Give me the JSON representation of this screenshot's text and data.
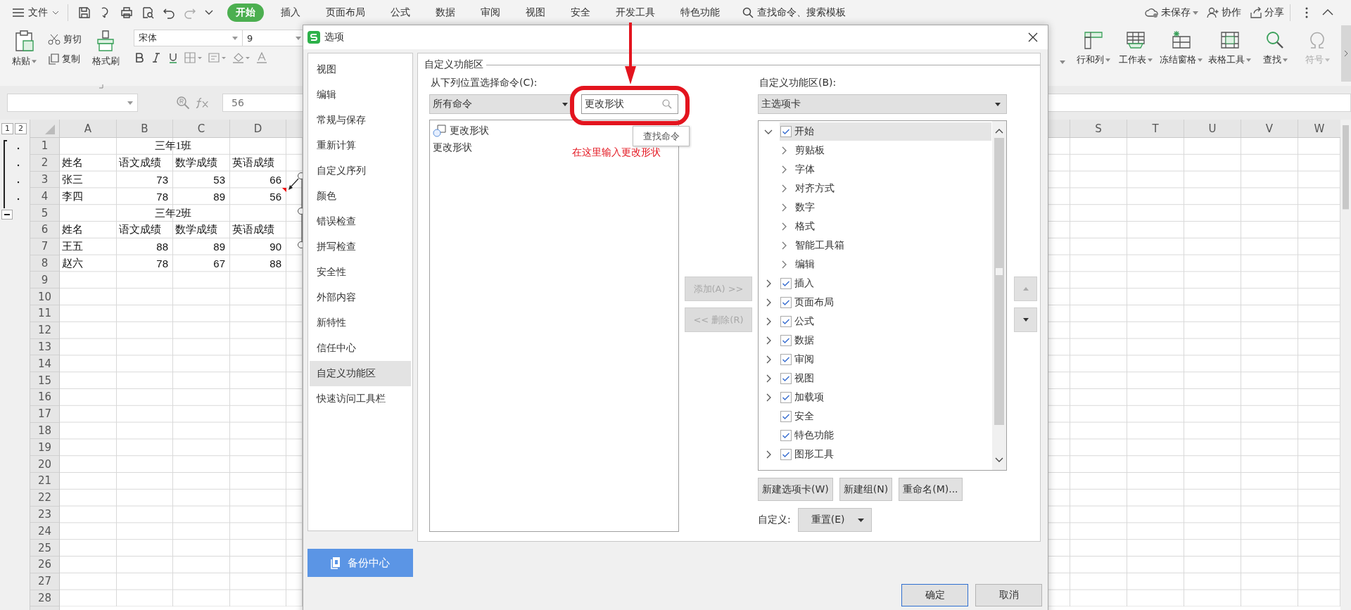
{
  "menu_bar": {
    "file_menu": "文件",
    "tabs": [
      {
        "label": "开始",
        "selected": true
      },
      {
        "label": "插入",
        "selected": false
      },
      {
        "label": "页面布局",
        "selected": false
      },
      {
        "label": "公式",
        "selected": false
      },
      {
        "label": "数据",
        "selected": false
      },
      {
        "label": "审阅",
        "selected": false
      },
      {
        "label": "视图",
        "selected": false
      },
      {
        "label": "安全",
        "selected": false
      },
      {
        "label": "开发工具",
        "selected": false
      },
      {
        "label": "特色功能",
        "selected": false
      }
    ],
    "search": "查找命令、搜索模板",
    "actions": [
      {
        "label": "未保存",
        "kind": "cloud"
      },
      {
        "label": "协作",
        "kind": "people"
      },
      {
        "label": "分享",
        "kind": "share"
      }
    ]
  },
  "ribbon": {
    "paste": "粘贴",
    "cut": "剪切",
    "copy": "复制",
    "format_painter": "格式刷",
    "font_name": "宋体",
    "font_size": "9",
    "tools": [
      {
        "label": "行和列",
        "kind": "rowcol",
        "disabled": false
      },
      {
        "label": "工作表",
        "kind": "sheet",
        "disabled": false
      },
      {
        "label": "冻结窗格",
        "kind": "freeze",
        "disabled": false
      },
      {
        "label": "表格工具",
        "kind": "table",
        "disabled": false
      },
      {
        "label": "查找",
        "kind": "find",
        "disabled": false
      },
      {
        "label": "符号",
        "kind": "symbol",
        "disabled": true
      }
    ]
  },
  "formula_bar": {
    "value": "56"
  },
  "sheet": {
    "outline_levels": [
      "1",
      "2"
    ],
    "columns": [
      "A",
      "B",
      "C",
      "D"
    ],
    "columns_right": [
      "S",
      "T",
      "U",
      "V",
      "W"
    ],
    "row_numbers": [
      "1",
      "2",
      "3",
      "4",
      "5",
      "6",
      "7",
      "8",
      "9",
      "10",
      "11",
      "12",
      "13",
      "14",
      "15",
      "16",
      "17",
      "18",
      "19",
      "20",
      "21",
      "22",
      "23",
      "24",
      "25",
      "26",
      "27",
      "28"
    ],
    "rows": [
      {
        "kind": "title",
        "text": "三年1班"
      },
      {
        "kind": "cells",
        "cells": [
          {
            "text": "姓名",
            "kind": "text"
          },
          {
            "text": "语文成绩",
            "kind": "text"
          },
          {
            "text": "数学成绩",
            "kind": "text"
          },
          {
            "text": "英语成绩",
            "kind": "text"
          }
        ]
      },
      {
        "kind": "cells",
        "cells": [
          {
            "text": "张三",
            "kind": "text"
          },
          {
            "text": "73",
            "kind": "number"
          },
          {
            "text": "53",
            "kind": "number"
          },
          {
            "text": "66",
            "kind": "number"
          }
        ]
      },
      {
        "kind": "cells",
        "cells": [
          {
            "text": "李四",
            "kind": "text"
          },
          {
            "text": "78",
            "kind": "number"
          },
          {
            "text": "89",
            "kind": "number"
          },
          {
            "text": "56",
            "kind": "number"
          }
        ]
      },
      {
        "kind": "title",
        "text": "三年2班"
      },
      {
        "kind": "cells",
        "cells": [
          {
            "text": "姓名",
            "kind": "text"
          },
          {
            "text": "语文成绩",
            "kind": "text"
          },
          {
            "text": "数学成绩",
            "kind": "text"
          },
          {
            "text": "英语成绩",
            "kind": "text"
          }
        ]
      },
      {
        "kind": "cells",
        "cells": [
          {
            "text": "王五",
            "kind": "text"
          },
          {
            "text": "88",
            "kind": "number"
          },
          {
            "text": "89",
            "kind": "number"
          },
          {
            "text": "90",
            "kind": "number"
          }
        ]
      },
      {
        "kind": "cells",
        "cells": [
          {
            "text": "赵六",
            "kind": "text"
          },
          {
            "text": "78",
            "kind": "number"
          },
          {
            "text": "67",
            "kind": "number"
          },
          {
            "text": "88",
            "kind": "number"
          }
        ]
      }
    ]
  },
  "dialog": {
    "title": "选项",
    "nav": [
      {
        "label": "视图",
        "selected": false
      },
      {
        "label": "编辑",
        "selected": false
      },
      {
        "label": "常规与保存",
        "selected": false
      },
      {
        "label": "重新计算",
        "selected": false
      },
      {
        "label": "自定义序列",
        "selected": false
      },
      {
        "label": "颜色",
        "selected": false
      },
      {
        "label": "错误检查",
        "selected": false
      },
      {
        "label": "拼写检查",
        "selected": false
      },
      {
        "label": "安全性",
        "selected": false
      },
      {
        "label": "外部内容",
        "selected": false
      },
      {
        "label": "新特性",
        "selected": false
      },
      {
        "label": "信任中心",
        "selected": false
      },
      {
        "label": "自定义功能区",
        "selected": true
      },
      {
        "label": "快速访问工具栏",
        "selected": false
      }
    ],
    "backup_button": "备份中心",
    "section_title": "自定义功能区",
    "commands_label": "从下列位置选择命令(C):",
    "commands_source": "所有命令",
    "search_value": "更改形状",
    "search_tooltip": "查找命令",
    "commands": [
      {
        "label": "更改形状",
        "kind": "shape"
      },
      {
        "label": "更改形状",
        "kind": "plain"
      }
    ],
    "add_button": {
      "label": "添加(A) >>",
      "disabled": true
    },
    "remove_button": {
      "label": "<< 删除(R)",
      "disabled": true
    },
    "ribbon_label": "自定义功能区(B):",
    "ribbon_source": "主选项卡",
    "tree": [
      {
        "label": "开始",
        "checked": true,
        "selected": true,
        "expandable": true,
        "expanded": true,
        "children": [
          {
            "label": "剪贴板"
          },
          {
            "label": "字体"
          },
          {
            "label": "对齐方式"
          },
          {
            "label": "数字"
          },
          {
            "label": "格式"
          },
          {
            "label": "智能工具箱"
          },
          {
            "label": "编辑"
          }
        ]
      },
      {
        "label": "插入",
        "checked": true,
        "selected": false,
        "expandable": true,
        "expanded": false
      },
      {
        "label": "页面布局",
        "checked": true,
        "selected": false,
        "expandable": true,
        "expanded": false
      },
      {
        "label": "公式",
        "checked": true,
        "selected": false,
        "expandable": true,
        "expanded": false
      },
      {
        "label": "数据",
        "checked": true,
        "selected": false,
        "expandable": true,
        "expanded": false
      },
      {
        "label": "审阅",
        "checked": true,
        "selected": false,
        "expandable": true,
        "expanded": false
      },
      {
        "label": "视图",
        "checked": true,
        "selected": false,
        "expandable": true,
        "expanded": false
      },
      {
        "label": "加载项",
        "checked": true,
        "selected": false,
        "expandable": true,
        "expanded": false
      },
      {
        "label": "安全",
        "checked": true,
        "selected": false,
        "expandable": false
      },
      {
        "label": "特色功能",
        "checked": true,
        "selected": false,
        "expandable": false
      },
      {
        "label": "图形工具",
        "checked": true,
        "selected": false,
        "expandable": true,
        "expanded": false
      }
    ],
    "tree_buttons": [
      "新建选项卡(W)",
      "新建组(N)",
      "重命名(M)..."
    ],
    "customize_label": "自定义:",
    "reset_button": "重置(E)",
    "ok_button": "确定",
    "cancel_button": "取消"
  },
  "annotation": {
    "text": "在这里输入更改形状"
  }
}
